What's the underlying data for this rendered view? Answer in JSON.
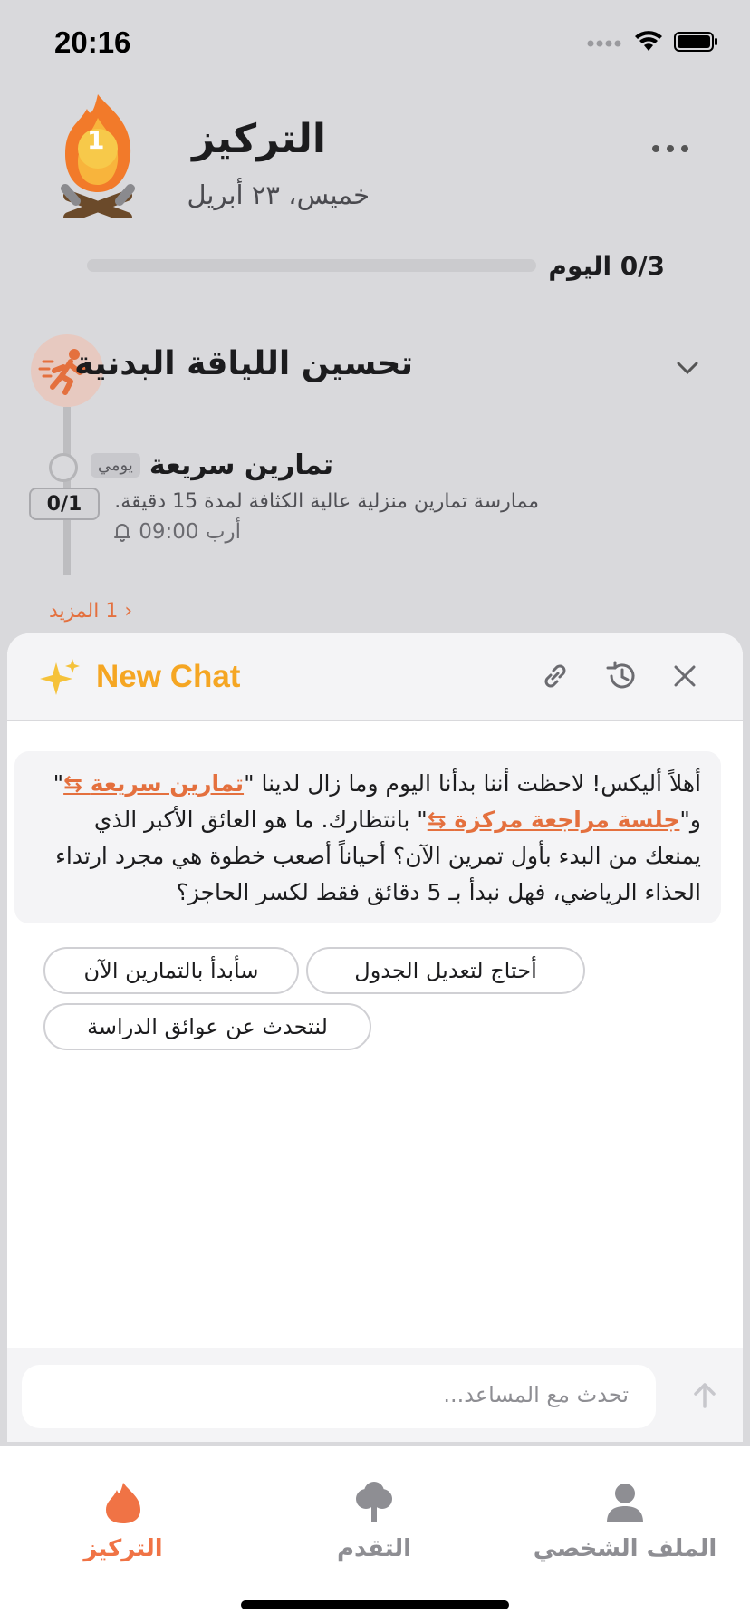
{
  "status_bar": {
    "time": "20:16"
  },
  "header": {
    "title": "التركيز",
    "date": "خميس، ٢٣ أبريل",
    "streak_count": "1",
    "progress_label": "0/3 اليوم",
    "progress_fraction": 0
  },
  "goal": {
    "title": "تحسين اللياقة البدنية",
    "task": {
      "title": "تمارين سريعة",
      "badge": "يومي",
      "description": "ممارسة تمارين منزلية عالية الكثافة لمدة 15 دقيقة.",
      "time": "أرب 09:00",
      "counter": "0/1"
    },
    "more_label": "‹ 1 المزيد"
  },
  "chat": {
    "title": "New Chat",
    "message": {
      "part1": "أهلاً أليكس! لاحظت أننا بدأنا اليوم وما زال لدينا \"",
      "link1": "تمارين سريعة",
      "part2": "\" و\"",
      "link2": "جلسة مراجعة مركزة",
      "part3": "\" بانتظارك. ما هو العائق الأكبر الذي يمنعك من البدء بأول تمرين الآن؟ أحياناً أصعب خطوة هي مجرد ارتداء الحذاء الرياضي، فهل نبدأ بـ 5 دقائق فقط لكسر الحاجز؟"
    },
    "suggestions": [
      "أحتاج لتعديل الجدول",
      "سأبدأ بالتمارين الآن",
      "لنتحدث عن عوائق الدراسة"
    ],
    "input_placeholder": "تحدث مع المساعد..."
  },
  "tabbar": {
    "focus": "التركيز",
    "progress": "التقدم",
    "profile": "الملف الشخصي"
  },
  "colors": {
    "accent": "#e4703e",
    "chat_title": "#f5a623"
  }
}
